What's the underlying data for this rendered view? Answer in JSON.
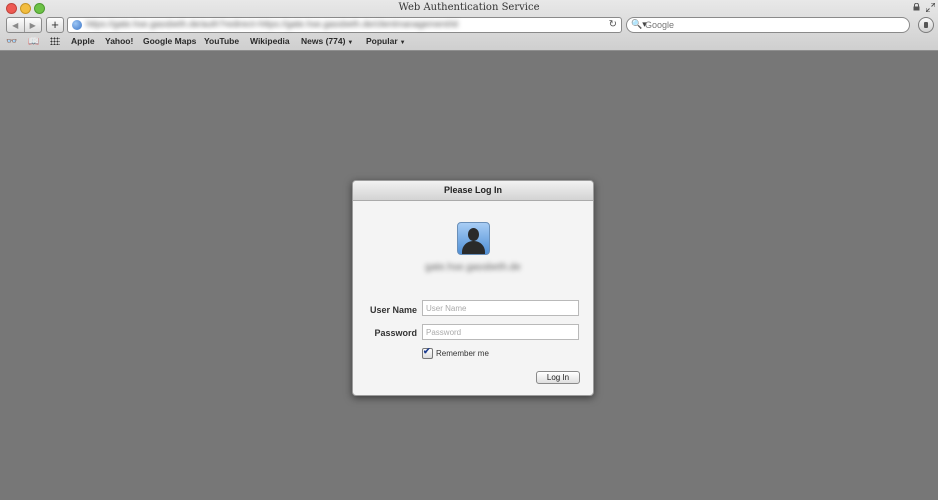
{
  "window": {
    "title": "Web Authentication Service"
  },
  "toolbar": {
    "back_glyph": "◀",
    "forward_glyph": "▶",
    "new_tab_glyph": "+",
    "address_text": "https://gate.hse.gassbeth.de/auth?redirect=https://gate.hse.gassbeth.de/clientmanagement/id",
    "reload_glyph": "↻",
    "search_placeholder": "Google",
    "search_icon_glyph": "🔍▾"
  },
  "bookmarks": {
    "reader_glyph": "👓",
    "book_glyph": "📖",
    "items": [
      {
        "label": "Apple"
      },
      {
        "label": "Yahoo!"
      },
      {
        "label": "Google Maps"
      },
      {
        "label": "YouTube"
      },
      {
        "label": "Wikipedia"
      },
      {
        "label": "News (774)"
      },
      {
        "label": "Popular"
      }
    ],
    "caret_glyph": "▼"
  },
  "dialog": {
    "title": "Please Log In",
    "server_name": "gate.hse.gassbeth.de",
    "user_label": "User Name",
    "user_placeholder": "User Name",
    "password_label": "Password",
    "password_placeholder": "Password",
    "remember_label": "Remember me",
    "remember_checked": true,
    "check_glyph": "✔",
    "login_label": "Log In"
  }
}
